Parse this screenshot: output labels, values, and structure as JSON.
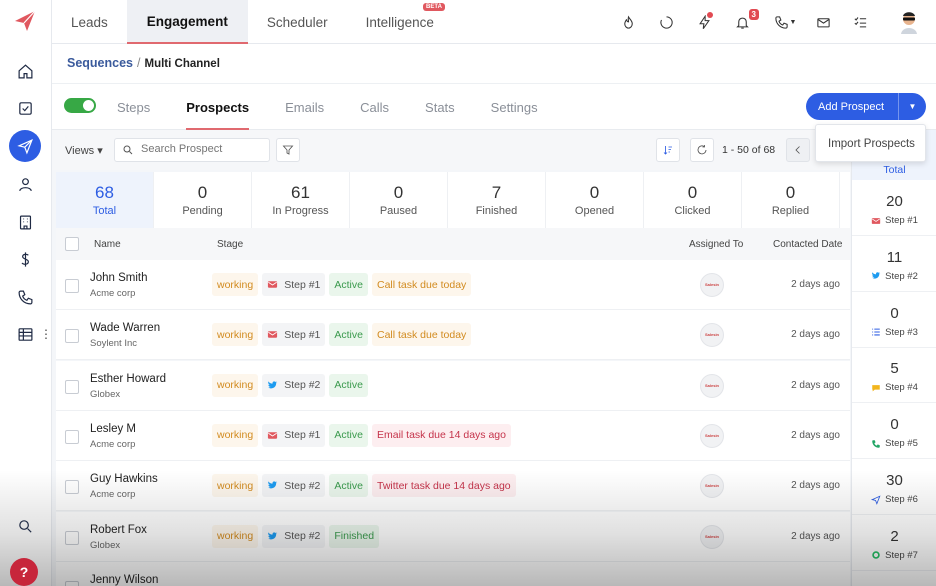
{
  "topnav": {
    "items": [
      "Leads",
      "Engagement",
      "Scheduler",
      "Intelligence"
    ],
    "beta": "BETA",
    "notifications": "3"
  },
  "breadcrumb": {
    "parent": "Sequences",
    "sep": "/",
    "current": "Multi Channel"
  },
  "tabs": [
    "Steps",
    "Prospects",
    "Emails",
    "Calls",
    "Stats",
    "Settings"
  ],
  "add_prospect": "Add Prospect",
  "dropdown_item": "Import Prospects",
  "toolbar": {
    "views": "Views ▾",
    "search_placeholder": "Search Prospect",
    "pager": "1 - 50 of 68"
  },
  "stats": [
    {
      "value": "68",
      "label": "Total"
    },
    {
      "value": "0",
      "label": "Pending"
    },
    {
      "value": "61",
      "label": "In Progress"
    },
    {
      "value": "0",
      "label": "Paused"
    },
    {
      "value": "7",
      "label": "Finished"
    },
    {
      "value": "0",
      "label": "Opened"
    },
    {
      "value": "0",
      "label": "Clicked"
    },
    {
      "value": "0",
      "label": "Replied"
    }
  ],
  "table": {
    "headers": {
      "name": "Name",
      "stage": "Stage",
      "assigned": "Assigned To",
      "contacted": "Contacted Date"
    },
    "rows": [
      {
        "name": "John Smith",
        "company": "Acme corp",
        "stage": "working",
        "step": "Step #1",
        "status": "Active",
        "due": "Call task due today",
        "date": "2 days ago"
      },
      {
        "name": "Wade Warren",
        "company": "Soylent Inc",
        "stage": "working",
        "step": "Step #1",
        "status": "Active",
        "due": "Call task due today",
        "date": "2 days ago"
      },
      {
        "name": "Esther Howard",
        "company": "Globex",
        "stage": "working",
        "step": "Step #2",
        "status": "Active",
        "due": "",
        "date": "2 days ago"
      },
      {
        "name": "Lesley M",
        "company": "Acme corp",
        "stage": "working",
        "step": "Step #1",
        "status": "Active",
        "due": "Email task due 14 days ago",
        "date": "2 days ago"
      },
      {
        "name": "Guy Hawkins",
        "company": "Acme corp",
        "stage": "working",
        "step": "Step #2",
        "status": "Active",
        "due": "Twitter task due 14 days ago",
        "date": "2 days ago"
      },
      {
        "name": "Robert Fox",
        "company": "Globex",
        "stage": "working",
        "step": "Step #2",
        "status": "Finished",
        "due": "",
        "date": "2 days ago"
      },
      {
        "name": "Jenny Wilson",
        "company": "",
        "stage": "",
        "step": "",
        "status": "",
        "due": "",
        "date": ""
      }
    ],
    "assignee_logo": "Salesin"
  },
  "side": {
    "total_label": "Total",
    "steps": [
      {
        "value": "20",
        "label": "Step #1",
        "icon": "mail-icon"
      },
      {
        "value": "11",
        "label": "Step #2",
        "icon": "twitter-icon"
      },
      {
        "value": "0",
        "label": "Step #3",
        "icon": "list-icon"
      },
      {
        "value": "5",
        "label": "Step #4",
        "icon": "chat-icon"
      },
      {
        "value": "0",
        "label": "Step #5",
        "icon": "phone-icon"
      },
      {
        "value": "30",
        "label": "Step #6",
        "icon": "send-icon"
      },
      {
        "value": "2",
        "label": "Step #7",
        "icon": "whatsapp-icon"
      }
    ]
  },
  "help": "?",
  "colors": {
    "accent": "#2d5de3",
    "tab_underline": "#e0696f",
    "toggle": "#37a845",
    "brand": "#e14a52"
  }
}
